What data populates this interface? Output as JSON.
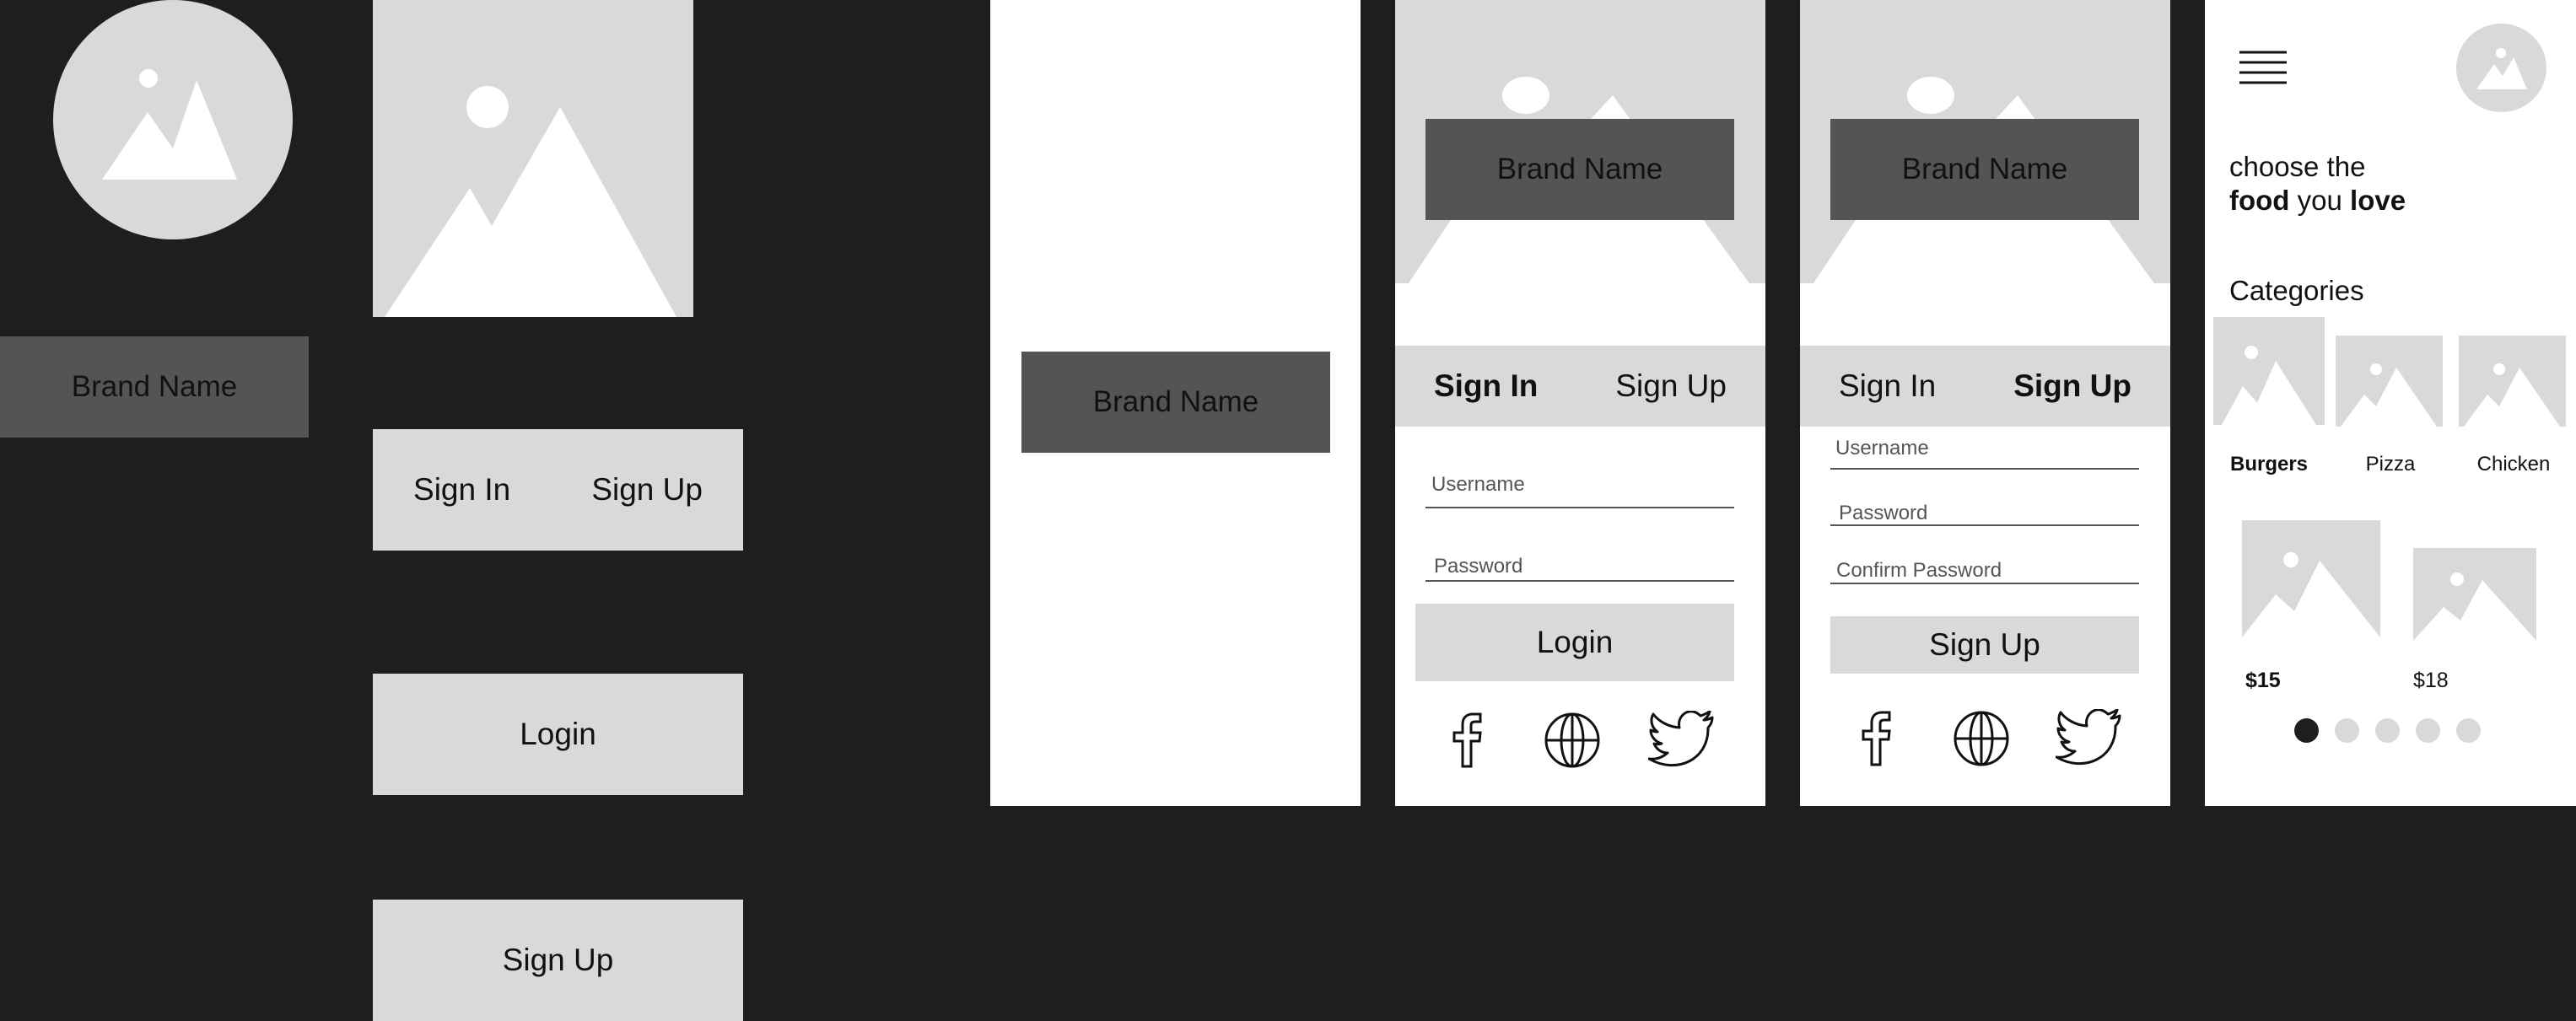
{
  "components": {
    "brand_label": "Brand Name",
    "tab_sign_in": "Sign In",
    "tab_sign_up": "Sign Up",
    "login_label": "Login",
    "signup_label": "Sign Up"
  },
  "splash": {
    "brand_label": "Brand Name"
  },
  "signin_screen": {
    "brand_label": "Brand Name",
    "tab_sign_in": "Sign In",
    "tab_sign_up": "Sign Up",
    "username_label": "Username",
    "password_label": "Password",
    "login_button": "Login",
    "social_icons": [
      "facebook-icon",
      "globe-icon",
      "twitter-icon"
    ]
  },
  "signup_screen": {
    "brand_label": "Brand Name",
    "tab_sign_in": "Sign In",
    "tab_sign_up": "Sign Up",
    "username_label": "Username",
    "password_label": "Password",
    "confirm_password_label": "Confirm Password",
    "signup_button": "Sign Up",
    "social_icons": [
      "facebook-icon",
      "globe-icon",
      "twitter-icon"
    ]
  },
  "home_screen": {
    "headline_part1": "choose the",
    "headline_bold1": "food",
    "headline_mid": "you",
    "headline_bold2": "love",
    "categories_title": "Categories",
    "categories": [
      {
        "label": "Burgers"
      },
      {
        "label": "Pizza"
      },
      {
        "label": "Chicken"
      }
    ],
    "products": [
      {
        "price": "$15"
      },
      {
        "price": "$18"
      }
    ],
    "carousel": {
      "total": 5,
      "active": 1
    }
  },
  "colors": {
    "background": "#1e1e1e",
    "placeholder": "#d9d9d9",
    "dark_button": "#545454",
    "screen": "#ffffff"
  }
}
